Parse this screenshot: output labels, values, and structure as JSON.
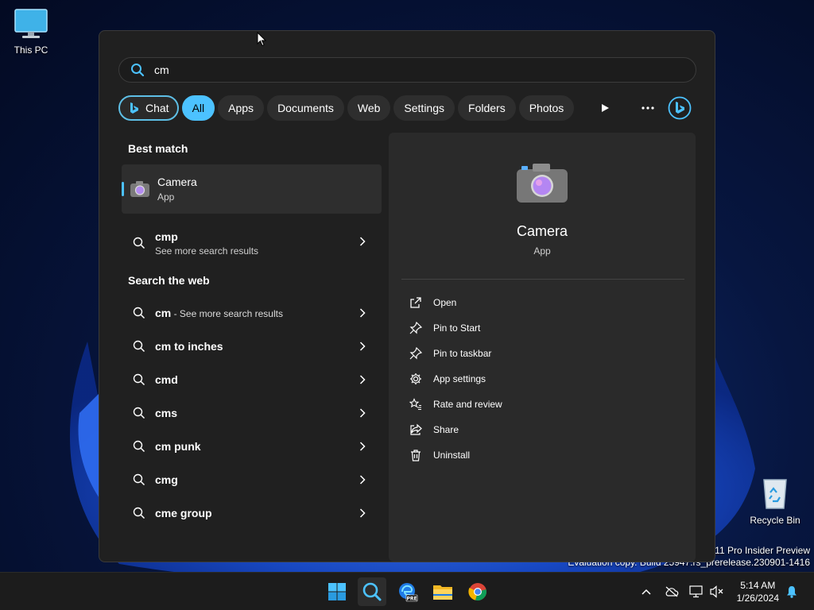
{
  "desktop": {
    "this_pc_label": "This PC",
    "recycle_bin_label": "Recycle Bin",
    "watermark_line1": "s 11 Pro Insider Preview",
    "watermark_line2": "Evaluation copy. Build 25947.rs_prerelease.230901-1416"
  },
  "search": {
    "query": "cm",
    "filters": [
      "Chat",
      "All",
      "Apps",
      "Documents",
      "Web",
      "Settings",
      "Folders",
      "Photos"
    ],
    "active_filter": "All"
  },
  "results": {
    "best_match_heading": "Best match",
    "best_match": {
      "title": "Camera",
      "type": "App"
    },
    "more_result": {
      "title": "cmp",
      "subtitle": "See more search results"
    },
    "web_heading": "Search the web",
    "web_first": {
      "title": "cm",
      "suffix": " - See more search results"
    },
    "web_items": [
      "cm to inches",
      "cmd",
      "cms",
      "cm punk",
      "cmg",
      "cme group"
    ]
  },
  "preview": {
    "title": "Camera",
    "type": "App",
    "actions": [
      "Open",
      "Pin to Start",
      "Pin to taskbar",
      "App settings",
      "Rate and review",
      "Share",
      "Uninstall"
    ]
  },
  "taskbar": {
    "time": "5:14 AM",
    "date": "1/26/2024",
    "apps": [
      "start-icon",
      "search-icon",
      "edge-beta-icon",
      "file-explorer-icon",
      "chrome-icon"
    ]
  },
  "colors": {
    "accent": "#4cc2ff",
    "panel": "#202020",
    "preview_bg": "#2a2a2a"
  }
}
